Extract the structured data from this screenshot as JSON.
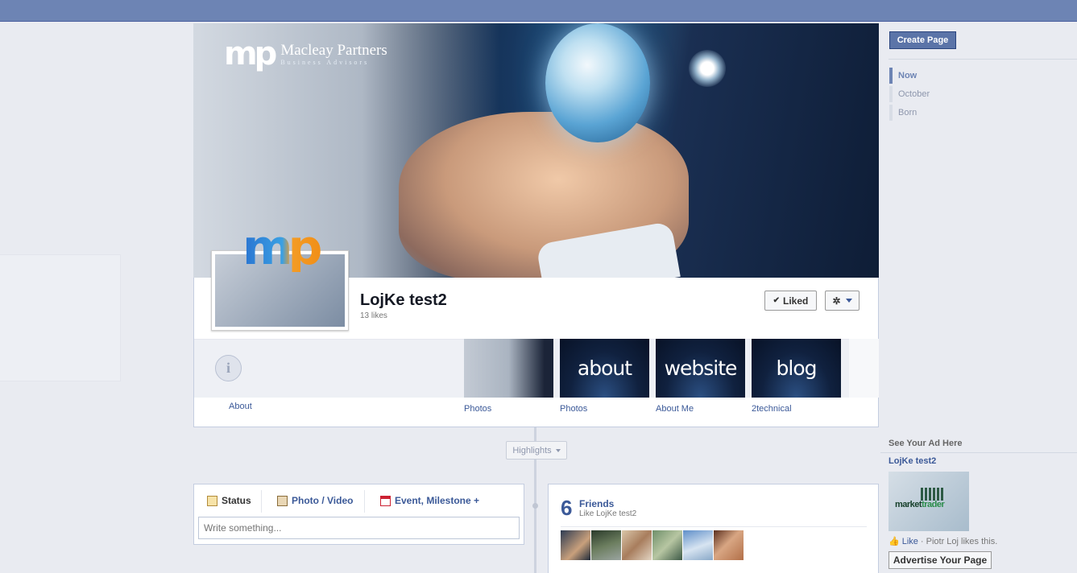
{
  "cover": {
    "brand_name": "Macleay Partners",
    "brand_tagline": "Business Advisors",
    "brand_mark": "mp"
  },
  "page": {
    "title": "LojKe test2",
    "likes": "13 likes",
    "liked_label": "Liked",
    "profile_mark": "mp"
  },
  "apps": [
    {
      "label": "About"
    },
    {
      "label": "Photos",
      "thumb_text": ""
    },
    {
      "label": "Photos",
      "thumb_text": "about"
    },
    {
      "label": "About Me",
      "thumb_text": "website"
    },
    {
      "label": "2technical",
      "thumb_text": "blog"
    }
  ],
  "timeline": {
    "highlights_label": "Highlights"
  },
  "composer": {
    "tabs": [
      {
        "label": "Status"
      },
      {
        "label": "Photo / Video"
      },
      {
        "label": "Event, Milestone +"
      }
    ],
    "placeholder": "Write something..."
  },
  "friends": {
    "count": "6",
    "title": "Friends",
    "subtitle": "Like LojKe test2"
  },
  "sidebar": {
    "create_page_label": "Create Page",
    "timeline_nav": [
      {
        "label": "Now"
      },
      {
        "label": "October"
      },
      {
        "label": "Born"
      }
    ],
    "ad_heading": "See Your Ad Here",
    "ad_title": "LojKe test2",
    "ad_image_text_a": "market",
    "ad_image_text_b": "trader",
    "ad_like_label": "Like",
    "ad_like_text": "· Piotr Loj likes this.",
    "advertise_label": "Advertise Your Page"
  },
  "colors": {
    "topbar": "#6d84b4",
    "link": "#3b5998",
    "page_bg": "#e9ebf1"
  }
}
